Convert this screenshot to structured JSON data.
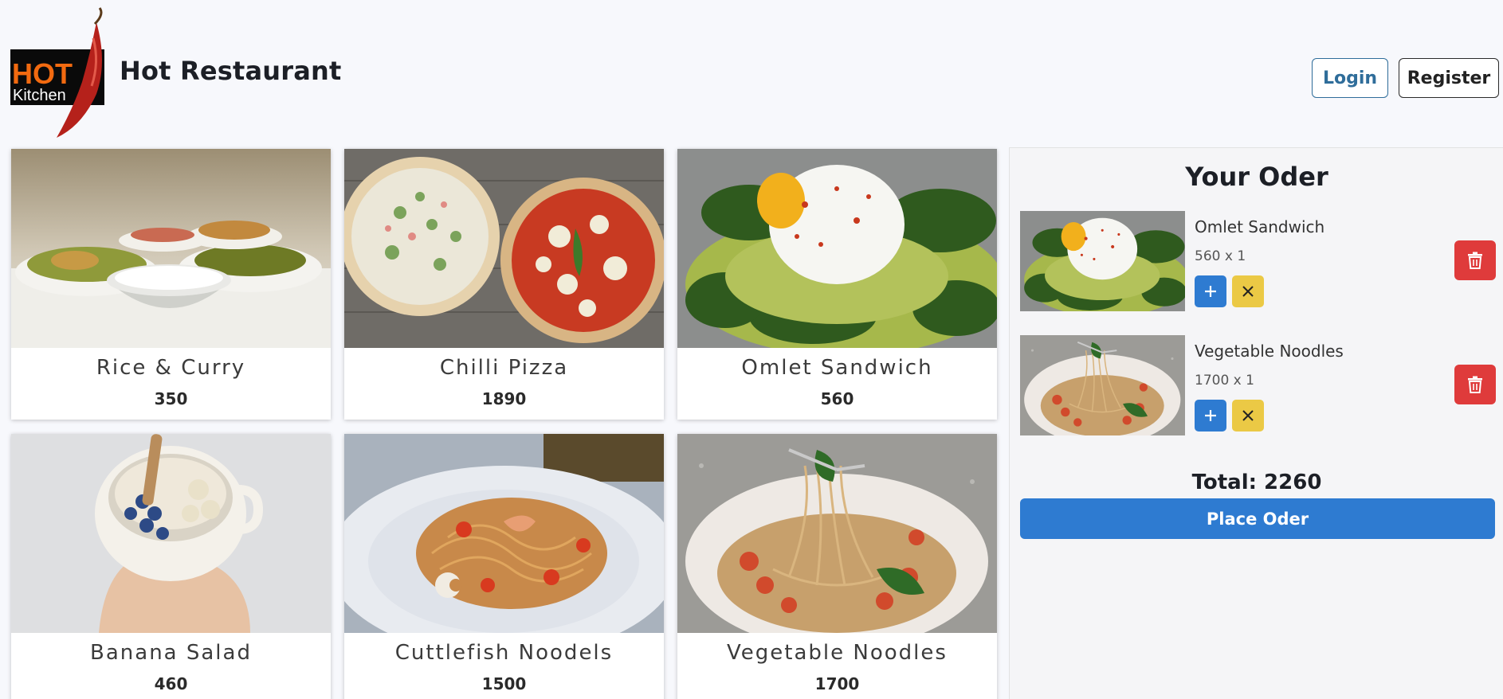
{
  "header": {
    "logo": {
      "line1": "HOT",
      "line2": "Kitchen"
    },
    "title": "Hot Restaurant",
    "login_label": "Login",
    "register_label": "Register"
  },
  "menu": {
    "items": [
      {
        "name": "Rice & Curry",
        "price": "350"
      },
      {
        "name": "Chilli Pizza",
        "price": "1890"
      },
      {
        "name": "Omlet Sandwich",
        "price": "560"
      },
      {
        "name": "Banana Salad",
        "price": "460"
      },
      {
        "name": "Cuttlefish Noodels",
        "price": "1500"
      },
      {
        "name": "Vegetable Noodles",
        "price": "1700"
      }
    ]
  },
  "order": {
    "title": "Your Oder",
    "items": [
      {
        "name": "Omlet Sandwich",
        "qty": "560 x 1"
      },
      {
        "name": "Vegetable Noodles",
        "qty": "1700 x 1"
      }
    ],
    "total": "Total: 2260",
    "place_label": "Place Oder"
  },
  "icons": {
    "plus": "plus-icon",
    "close": "close-icon",
    "trash": "trash-icon",
    "chili": "chili-pepper-icon"
  },
  "colors": {
    "primary": "#2e7bd1",
    "danger": "#df3b3b",
    "warning": "#ebc945",
    "login_outline": "#2f6d9a",
    "logo_orange": "#f26a10"
  }
}
